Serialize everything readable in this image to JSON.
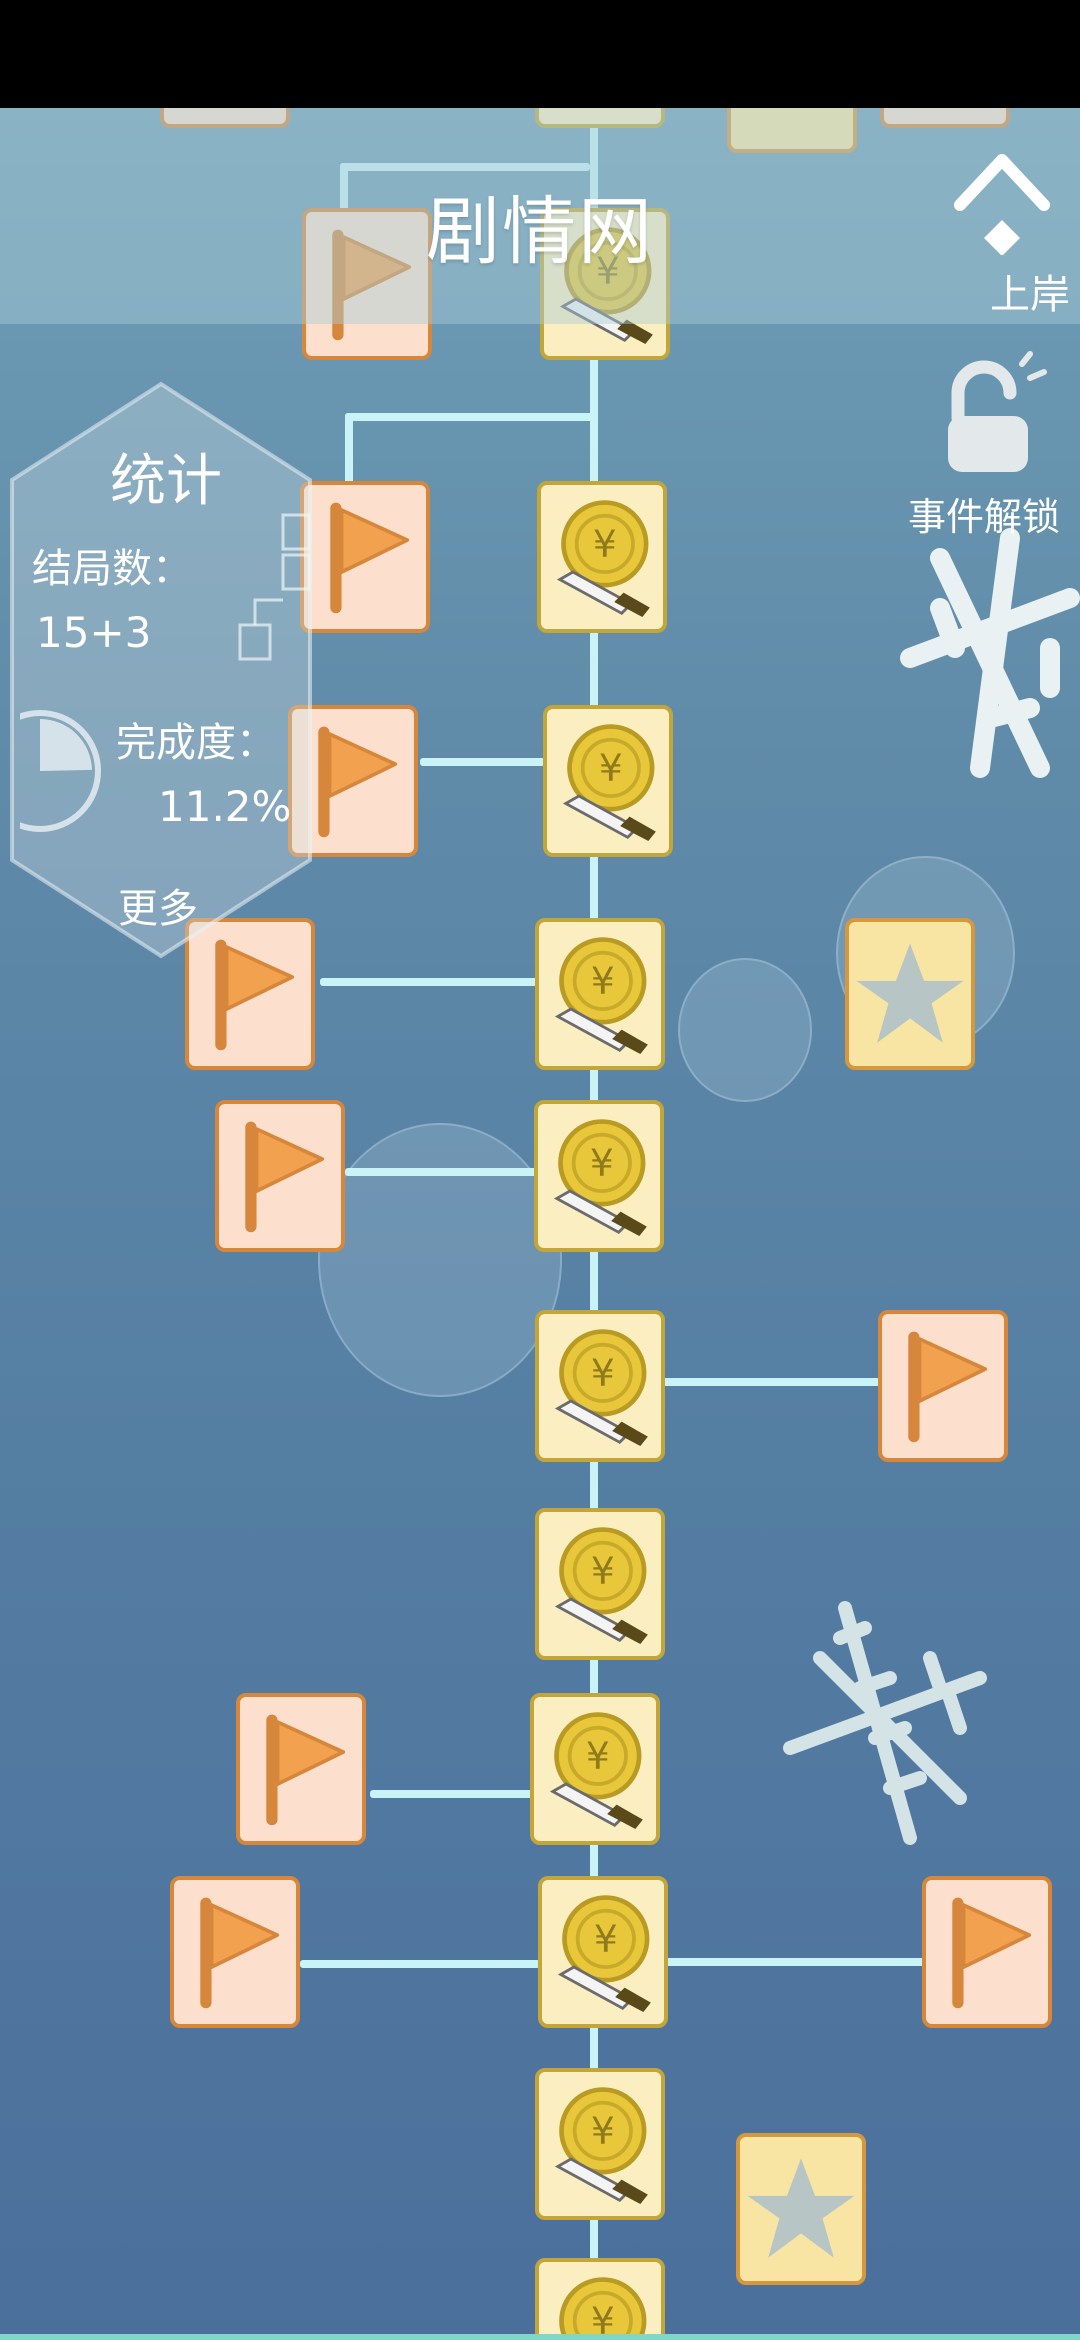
{
  "header": {
    "title": "剧情网",
    "shore_label": "上岸",
    "shore_icon": "chevron-up-icon",
    "unlock_label": "事件解锁",
    "unlock_icon": "unlock-icon"
  },
  "stats": {
    "title": "统计",
    "endings_label": "结局数：",
    "endings_value": "15+3",
    "completion_label": "完成度：",
    "completion_value": "11.2%",
    "completion_fraction": 0.112,
    "more_label": "更多"
  },
  "tree": {
    "node_types": [
      "coin",
      "flag",
      "star"
    ],
    "colors": {
      "flag_fill": "#fce0cd",
      "flag_border": "#d7873c",
      "flag_icon": "#f2a24f",
      "coin_fill": "#fbefc2",
      "coin_border": "#c2a63a",
      "coin_icon": "#e8c73a",
      "star_fill": "#f8e5a3",
      "star_icon": "#b7c6c4",
      "link": "#c9f3f6"
    }
  }
}
